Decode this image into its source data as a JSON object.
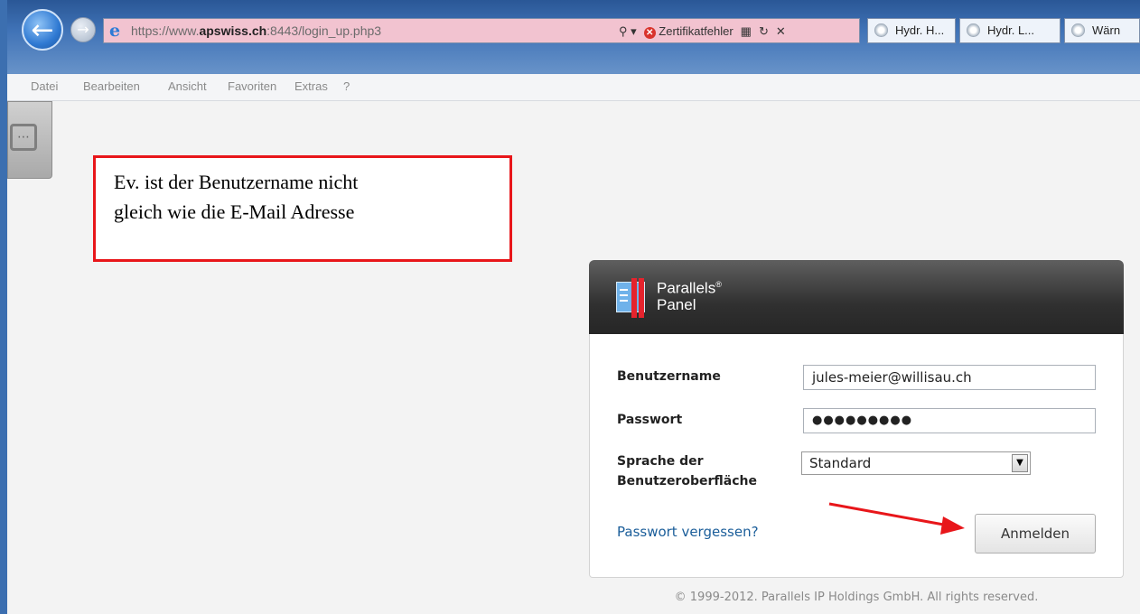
{
  "browser": {
    "url_prefix": "https://www.",
    "url_domain": "apswiss.ch",
    "url_suffix": ":8443/login_up.php3",
    "cert_error": "Zertifikatfehler",
    "tabs": [
      {
        "label": "Hydr. H..."
      },
      {
        "label": "Hydr. L..."
      },
      {
        "label": "Wärn"
      }
    ],
    "menu": [
      "Datei",
      "Bearbeiten",
      "Ansicht",
      "Favoriten",
      "Extras",
      "?"
    ],
    "icons": [
      "back-arrow-icon",
      "forward-arrow-icon",
      "ie-logo-icon",
      "search-icon",
      "cert-error-icon",
      "compat-view-icon",
      "refresh-icon",
      "stop-icon",
      "tab-page-icon"
    ]
  },
  "annotation": {
    "line1": "Ev. ist der Benutzername nicht",
    "line2": "gleich wie die E-Mail Adresse",
    "border_color": "#e8161a"
  },
  "panel": {
    "brand_line1": "Parallels",
    "brand_reg": "®",
    "brand_line2": "Panel",
    "username_label": "Benutzername",
    "username_value": "jules-meier@willisau.ch",
    "password_label": "Passwort",
    "password_value": "●●●●●●●●●",
    "language_label_line1": "Sprache der",
    "language_label_line2": "Benutzeroberfläche",
    "language_value": "Standard",
    "forgot_link": "Passwort vergessen?",
    "submit_label": "Anmelden"
  },
  "footer": {
    "copyright": "© 1999-2012. Parallels IP Holdings GmbH. All rights reserved."
  }
}
